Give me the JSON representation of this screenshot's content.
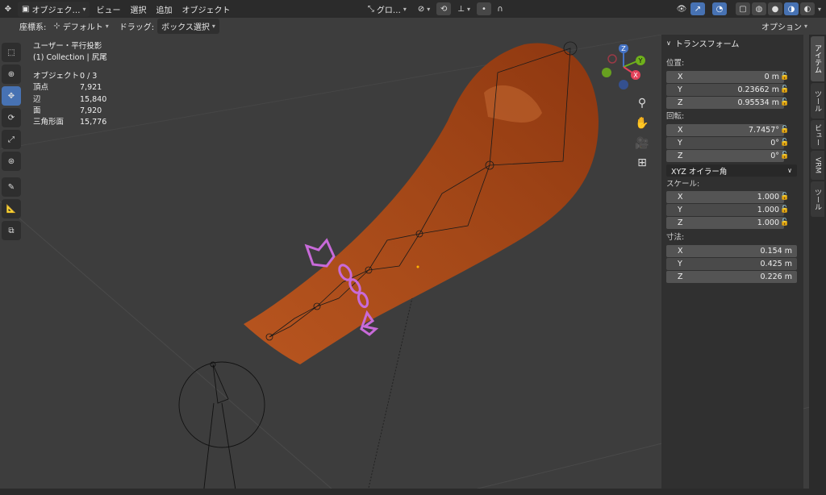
{
  "topbar": {
    "mode": "オブジェク…",
    "menus": [
      "ビュー",
      "選択",
      "追加",
      "オブジェクト"
    ],
    "transform_orientation": "グロ…"
  },
  "header": {
    "coord_label": "座標系:",
    "coord_value": "デフォルト",
    "drag_label": "ドラッグ:",
    "drag_value": "ボックス選択",
    "options": "オプション"
  },
  "viewport": {
    "view_name": "ユーザー・平行投影",
    "collection": "(1) Collection | 尻尾",
    "stats": [
      {
        "k": "オブジェクト",
        "v": "0 / 3"
      },
      {
        "k": "頂点",
        "v": "7,921"
      },
      {
        "k": "辺",
        "v": "15,840"
      },
      {
        "k": "面",
        "v": "7,920"
      },
      {
        "k": "三角形面",
        "v": "15,776"
      }
    ]
  },
  "gizmo": {
    "x": "X",
    "y": "Y",
    "z": "Z"
  },
  "npanel": {
    "title": "トランスフォーム",
    "location_label": "位置:",
    "location": {
      "x": "0 m",
      "y": "0.23662 m",
      "z": "0.95534 m"
    },
    "rotation_label": "回転:",
    "rotation": {
      "x": "7.7457°",
      "y": "0°",
      "z": "0°"
    },
    "rotation_mode": "XYZ オイラー角",
    "scale_label": "スケール:",
    "scale": {
      "x": "1.000",
      "y": "1.000",
      "z": "1.000"
    },
    "dimensions_label": "寸法:",
    "dimensions": {
      "x": "0.154 m",
      "y": "0.425 m",
      "z": "0.226 m"
    },
    "axis": {
      "x": "X",
      "y": "Y",
      "z": "Z"
    }
  },
  "vtabs": [
    "アイテム",
    "ツール",
    "ビュー",
    "VRM",
    "ツール"
  ],
  "colors": {
    "accent": "#4772b3",
    "tail": "#a8491a",
    "chain": "#c86ad9"
  }
}
